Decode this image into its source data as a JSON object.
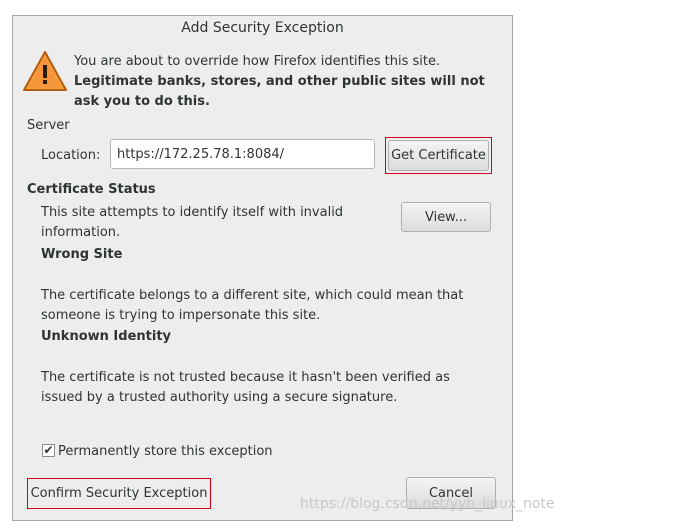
{
  "dialog": {
    "title": "Add Security Exception",
    "warning_line1": "You are about to override how Firefox identifies this site.",
    "warning_line2": "Legitimate banks, stores, and other public sites will not ask you to do this."
  },
  "server": {
    "section_label": "Server",
    "location_label": "Location:",
    "location_value": "https://172.25.78.1:8084/",
    "get_certificate_label": "Get Certificate"
  },
  "certificate_status": {
    "section_label": "Certificate Status",
    "intro": "This site attempts to identify itself with invalid information.",
    "view_label": "View...",
    "wrong_site_title": "Wrong Site",
    "wrong_site_text": "The certificate belongs to a different site, which could mean that someone is trying to impersonate this site.",
    "unknown_identity_title": "Unknown Identity",
    "unknown_identity_text": "The certificate is not trusted because it hasn't been verified as issued by a trusted authority using a secure signature."
  },
  "store": {
    "label": "Permanently store this exception",
    "checked": true,
    "check_glyph": "✔"
  },
  "actions": {
    "confirm_label": "Confirm Security Exception",
    "cancel_label": "Cancel"
  },
  "watermark": "https://blog.csdn.net/yyh_linux_note",
  "colors": {
    "dialog_bg": "#ededed",
    "highlight_box": "#d0021b",
    "warning_orange": "#e46c0a"
  }
}
